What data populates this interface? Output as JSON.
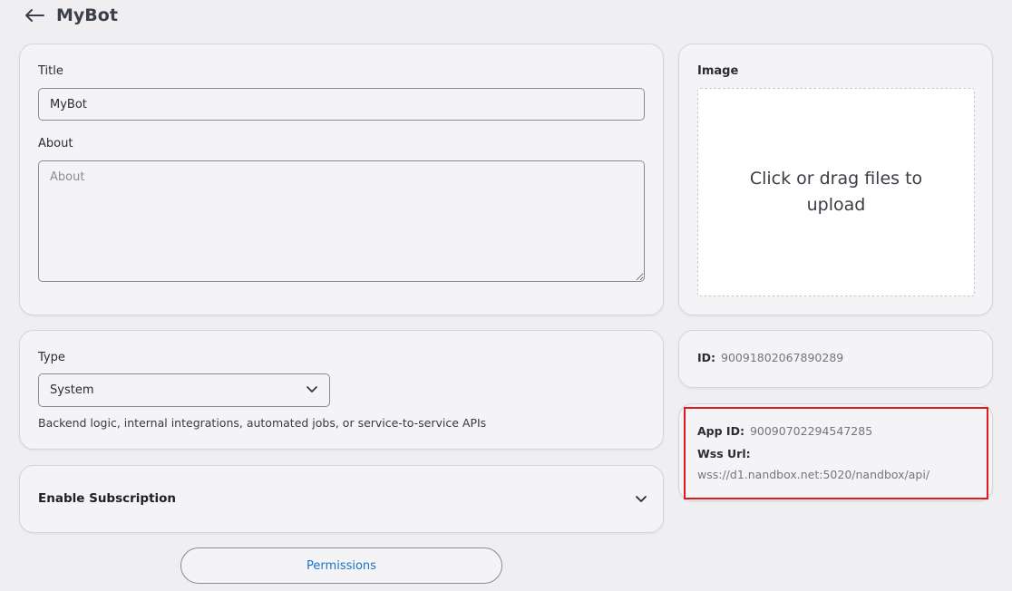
{
  "header": {
    "title": "MyBot"
  },
  "form": {
    "title_label": "Title",
    "title_value": "MyBot",
    "about_label": "About",
    "about_placeholder": "About"
  },
  "type": {
    "label": "Type",
    "selected": "System",
    "description": "Backend logic, internal integrations, automated jobs, or service-to-service APIs"
  },
  "subscription": {
    "label": "Enable Subscription"
  },
  "permissions": {
    "label": "Permissions"
  },
  "image": {
    "label": "Image",
    "dropzone_text": "Click or drag files to upload"
  },
  "info": {
    "id_label": "ID:",
    "id_value": "90091802067890289",
    "app_id_label": "App ID:",
    "app_id_value": "90090702294547285",
    "wss_label": "Wss Url:",
    "wss_value": "wss://d1.nandbox.net:5020/nandbox/api/"
  },
  "colors": {
    "accent_link": "#1a73c9",
    "highlight": "#e0191f",
    "background": "#efeef1"
  }
}
